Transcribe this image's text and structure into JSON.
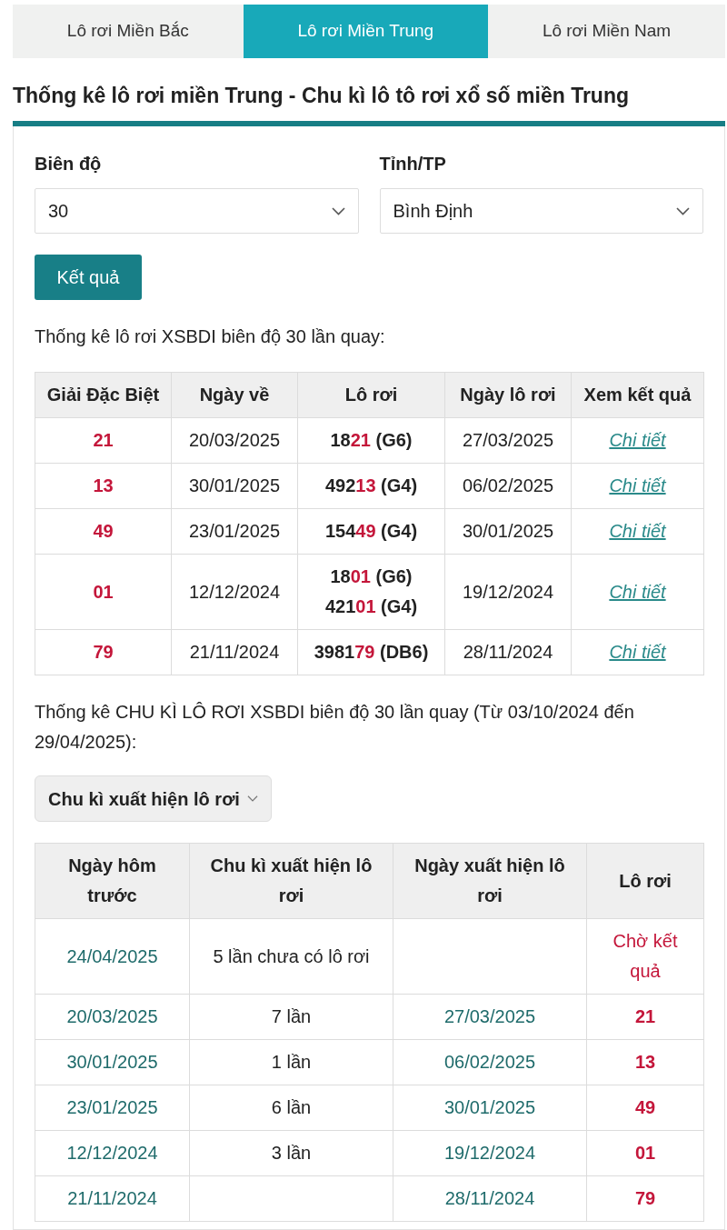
{
  "tabs": [
    {
      "label": "Lô rơi Miền Bắc",
      "selected": false
    },
    {
      "label": "Lô rơi Miền Trung",
      "selected": true
    },
    {
      "label": "Lô rơi Miền Nam",
      "selected": false
    }
  ],
  "heading": "Thống kê lô rơi miền Trung - Chu kì lô tô rơi xổ số miền Trung",
  "form": {
    "fields": [
      {
        "label": "Biên độ",
        "value": "30"
      },
      {
        "label": "Tỉnh/TP",
        "value": "Bình Định"
      }
    ],
    "submit": "Kết quả"
  },
  "summary": {
    "caption": "Thống kê lô rơi XSBDI biên độ 30 lần quay:",
    "table": {
      "columns": [
        "Giải Đặc Biệt",
        "Ngày về",
        "Lô rơi",
        "Ngày lô rơi",
        "Xem kết quả"
      ],
      "rows": [
        {
          "special": "21",
          "date": "20/03/2025",
          "hits": [
            {
              "head": "18",
              "tail": "21",
              "prize": "(G6)"
            }
          ],
          "drop_date": "27/03/2025",
          "link": "Chi tiết"
        },
        {
          "special": "13",
          "date": "30/01/2025",
          "hits": [
            {
              "head": "492",
              "tail": "13",
              "prize": "(G4)"
            }
          ],
          "drop_date": "06/02/2025",
          "link": "Chi tiết"
        },
        {
          "special": "49",
          "date": "23/01/2025",
          "hits": [
            {
              "head": "154",
              "tail": "49",
              "prize": "(G4)"
            }
          ],
          "drop_date": "30/01/2025",
          "link": "Chi tiết"
        },
        {
          "special": "01",
          "date": "12/12/2024",
          "hits": [
            {
              "head": "18",
              "tail": "01",
              "prize": "(G6)"
            },
            {
              "head": "421",
              "tail": "01",
              "prize": "(G4)"
            }
          ],
          "drop_date": "19/12/2024",
          "link": "Chi tiết"
        },
        {
          "special": "79",
          "date": "21/11/2024",
          "hits": [
            {
              "head": "3981",
              "tail": "79",
              "prize": "(DB6)"
            }
          ],
          "drop_date": "28/11/2024",
          "link": "Chi tiết"
        }
      ]
    }
  },
  "cycle": {
    "caption": "Thống kê CHU KÌ LÔ RƠI XSBDI biên độ 30 lần quay (Từ 03/10/2024 đến 29/04/2025):",
    "dropdown": "Chu kì xuất hiện lô rơi",
    "table": {
      "columns": [
        "Ngày hôm trước",
        "Chu kì xuất hiện lô rơi",
        "Ngày xuất hiện lô rơi",
        "Lô rơi"
      ],
      "rows": [
        {
          "previous_date": "24/04/2025",
          "cycle": "5 lần chưa có lô rơi",
          "lo_roi": "Chờ kết quả",
          "kind": "pending"
        },
        {
          "previous_date": "20/03/2025",
          "cycle": "7 lần",
          "drop_date": "27/03/2025",
          "lo_roi": "21",
          "kind": "number"
        },
        {
          "previous_date": "30/01/2025",
          "cycle": "1 lần",
          "drop_date": "06/02/2025",
          "lo_roi": "13",
          "kind": "number"
        },
        {
          "previous_date": "23/01/2025",
          "cycle": "6 lần",
          "drop_date": "30/01/2025",
          "lo_roi": "49",
          "kind": "number"
        },
        {
          "previous_date": "12/12/2024",
          "cycle": "3 lần",
          "drop_date": "19/12/2024",
          "lo_roi": "01",
          "kind": "number"
        },
        {
          "previous_date": "21/11/2024",
          "drop_date": "28/11/2024",
          "lo_roi": "79",
          "kind": "number"
        }
      ]
    }
  }
}
